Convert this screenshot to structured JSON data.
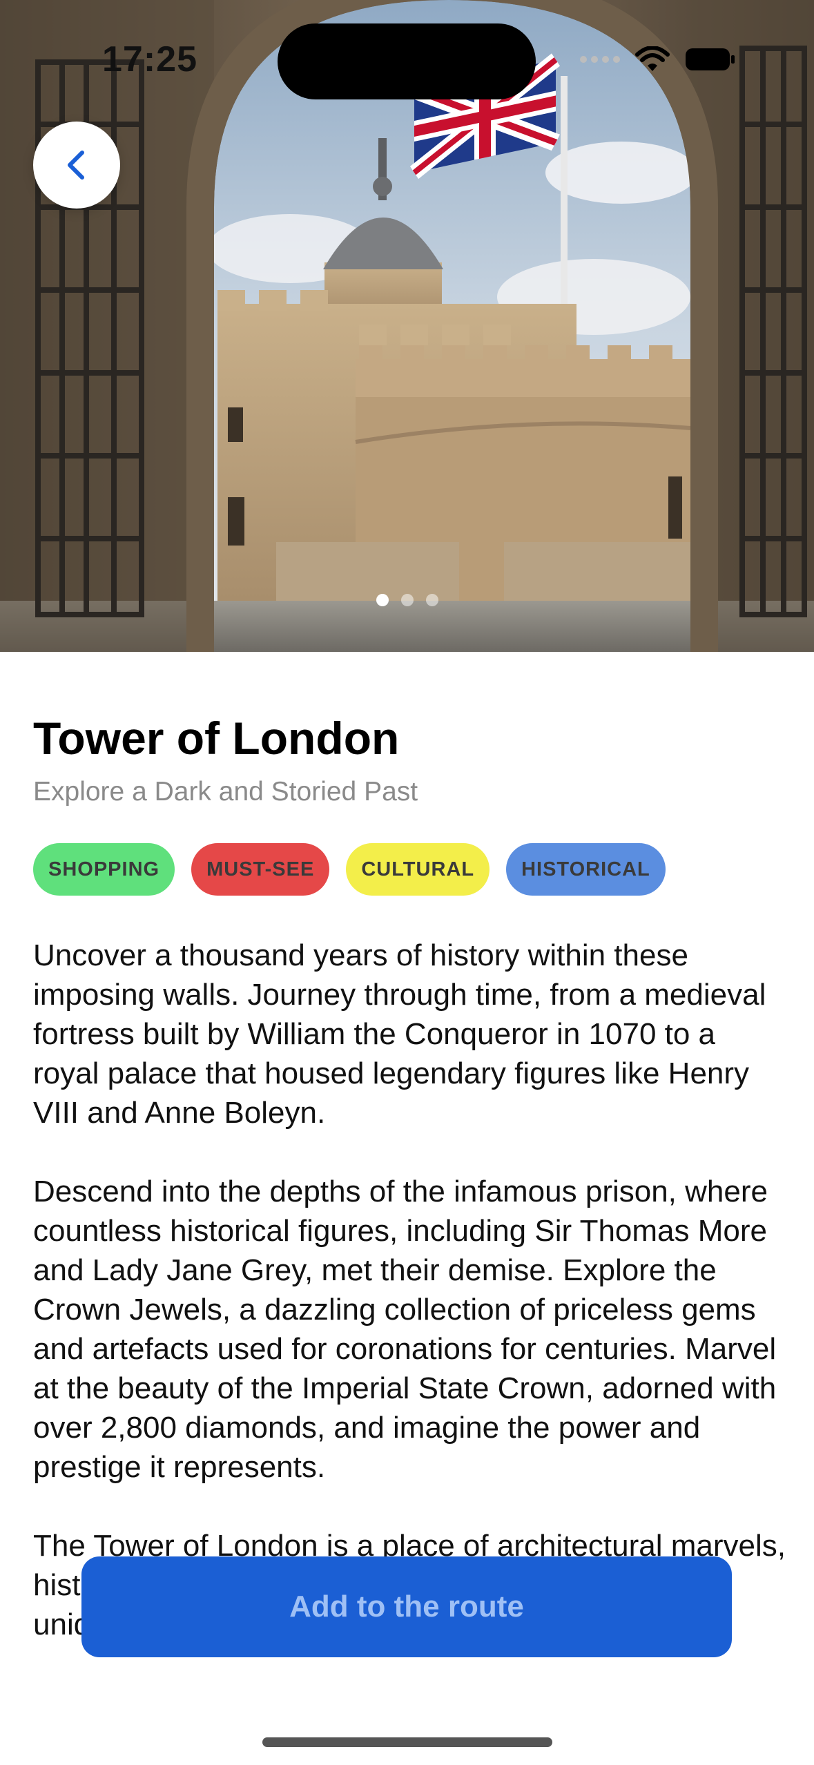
{
  "status_bar": {
    "time": "17:25"
  },
  "hero": {
    "image_desc": "Tower of London seen through castle gate with Union Jack flag",
    "page_count": 3,
    "active_page": 1
  },
  "back_button": {
    "icon": "chevron-left-icon"
  },
  "place": {
    "title": "Tower of London",
    "subtitle": "Explore a Dark and Storied Past"
  },
  "tags": [
    {
      "label": "SHOPPING",
      "color": "#5fe07c"
    },
    {
      "label": "MUST-SEE",
      "color": "#e54848"
    },
    {
      "label": "CULTURAL",
      "color": "#f3ee4a"
    },
    {
      "label": "HISTORICAL",
      "color": "#5b8ee0"
    }
  ],
  "description": [
    "Uncover a thousand years of history within these imposing walls. Journey through time, from a medieval fortress built by William the Conqueror in 1070 to a royal palace that housed legendary figures like Henry VIII and Anne Boleyn.",
    "Descend into the depths of the infamous prison, where countless historical figures, including Sir Thomas More and Lady Jane Grey, met their demise. Explore the Crown Jewels, a dazzling collection of priceless gems and artefacts used for coronations for centuries. Marvel at the beauty of the Imperial State Crown, adorned with over 2,800 diamonds, and imagine the power and prestige it represents.",
    "The Tower of London is a place of architectural marvels, historical significance, and chilling tales, offering a unique glimpse into London’s turbulent past."
  ],
  "cta": {
    "label": "Add to the route"
  }
}
